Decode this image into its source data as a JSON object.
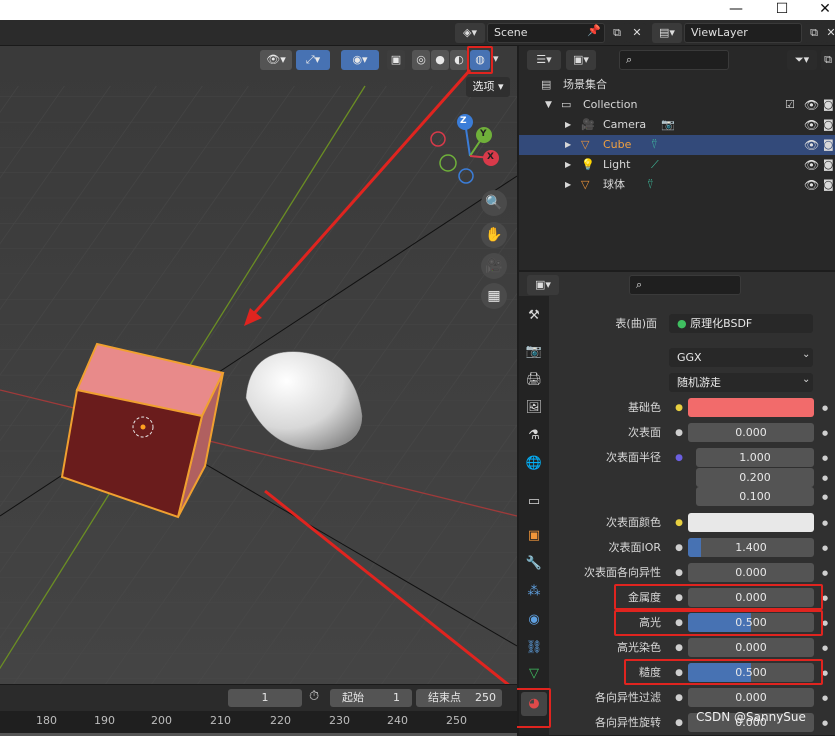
{
  "titlebar": {
    "minimize": "—",
    "maximize": "☐",
    "close": "✕"
  },
  "topbar": {
    "scene_label": "Scene",
    "viewlayer_label": "ViewLayer"
  },
  "viewport": {
    "options_label": "选项",
    "shading_modes": [
      "wireframe",
      "solid",
      "material-preview",
      "rendered"
    ],
    "gizmo_axes": [
      "Z",
      "Y",
      "X"
    ]
  },
  "outliner": {
    "search_placeholder": "",
    "root": "场景集合",
    "collection": "Collection",
    "items": [
      {
        "name": "Camera",
        "icon": "camera-icon",
        "selected": false
      },
      {
        "name": "Cube",
        "icon": "mesh-icon",
        "selected": true
      },
      {
        "name": "Light",
        "icon": "light-icon",
        "selected": false
      },
      {
        "name": "球体",
        "icon": "mesh-icon",
        "selected": false
      }
    ]
  },
  "properties": {
    "surface_label": "表(曲)面",
    "surface_value": "原理化BSDF",
    "distribution": "GGX",
    "subsurface_method": "随机游走",
    "rows": [
      {
        "label": "基础色",
        "value": "",
        "type": "color",
        "color": "#f26b6b"
      },
      {
        "label": "次表面",
        "value": "0.000",
        "fill": 0
      },
      {
        "label": "次表面半径",
        "value": "1.000",
        "fill": 0
      },
      {
        "label": "",
        "value": "0.200",
        "fill": 0
      },
      {
        "label": "",
        "value": "0.100",
        "fill": 0
      },
      {
        "label": "次表面颜色",
        "value": "",
        "type": "color",
        "color": "#e8e8e8"
      },
      {
        "label": "次表面IOR",
        "value": "1.400",
        "fill": 0.1
      },
      {
        "label": "次表面各向异性",
        "value": "0.000",
        "fill": 0
      },
      {
        "label": "金属度",
        "value": "0.000",
        "fill": 0,
        "highlight": true
      },
      {
        "label": "高光",
        "value": "0.500",
        "fill": 0.5,
        "highlight": true
      },
      {
        "label": "高光染色",
        "value": "0.000",
        "fill": 0
      },
      {
        "label": "糙度",
        "value": "0.500",
        "fill": 0.5,
        "highlight": true
      },
      {
        "label": "各向异性过滤",
        "value": "0.000",
        "fill": 0
      },
      {
        "label": "各向异性旋转",
        "value": "0.000",
        "fill": 0
      }
    ],
    "tabs": [
      "tool-icon",
      "render-icon",
      "output-icon",
      "view-layer-icon",
      "scene-icon",
      "world-icon",
      "collection-icon",
      "object-icon",
      "modifier-icon",
      "particles-icon",
      "physics-icon",
      "constraints-icon",
      "data-icon",
      "material-icon"
    ]
  },
  "timeline": {
    "current_frame": "1",
    "start_label": "起始",
    "start_value": "1",
    "end_label": "结束点",
    "end_value": "250",
    "ruler": [
      "180",
      "190",
      "200",
      "210",
      "220",
      "230",
      "240",
      "250"
    ]
  },
  "watermark": "CSDN @SannySue",
  "colors": {
    "accent": "#4772b3",
    "highlight_box": "#e0241f",
    "selection": "#334a7a"
  }
}
